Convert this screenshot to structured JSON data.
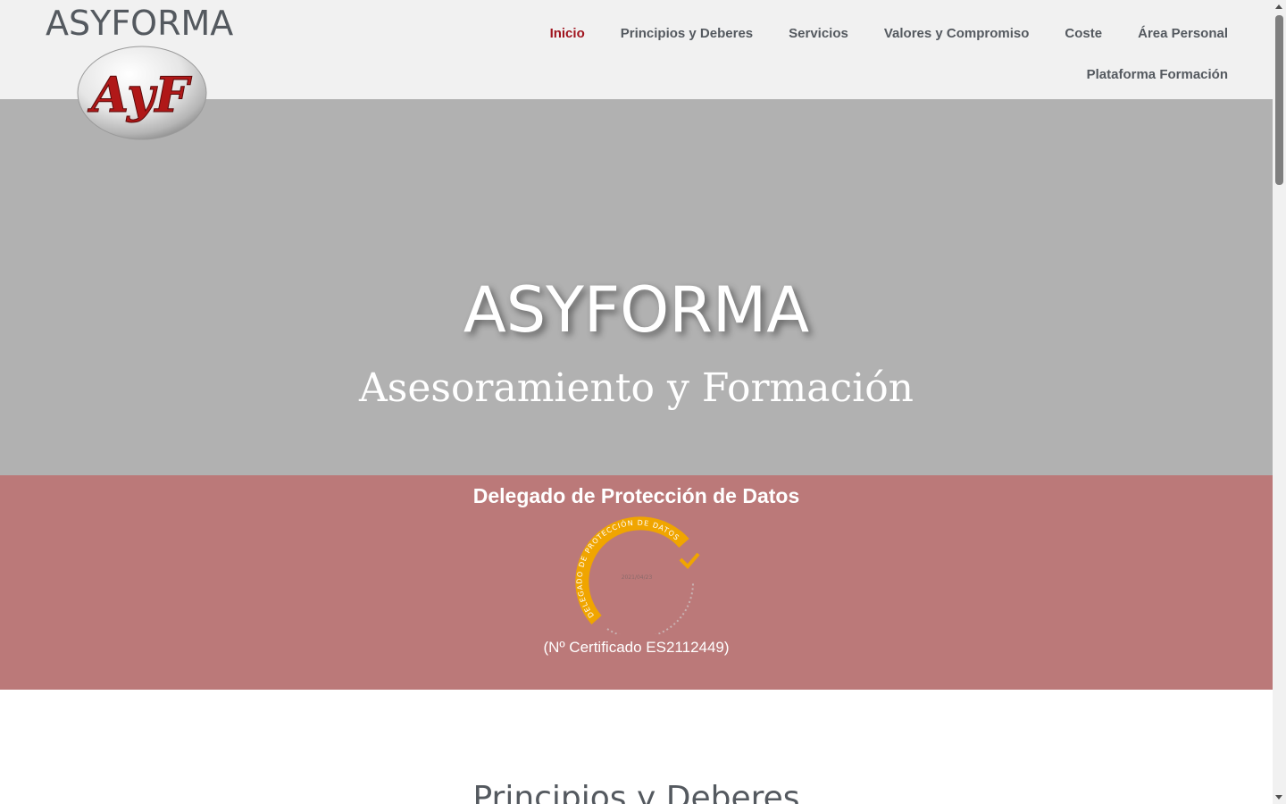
{
  "header": {
    "site_title": "ASYFORMA",
    "logo_text": "AyF",
    "nav": [
      {
        "label": "Inicio",
        "active": true
      },
      {
        "label": "Principios y Deberes",
        "active": false
      },
      {
        "label": "Servicios",
        "active": false
      },
      {
        "label": "Valores y Compromiso",
        "active": false
      },
      {
        "label": "Coste",
        "active": false
      },
      {
        "label": "Área Personal",
        "active": false
      },
      {
        "label": "Plataforma Formación",
        "active": false
      }
    ]
  },
  "hero": {
    "title": "ASYFORMA",
    "subtitle": "Asesoramiento y Formación"
  },
  "dpd": {
    "heading": "Delegado de Protección de Datos",
    "seal_text": "DELEGADO DE PROTECCIÓN DE DATOS",
    "seal_date": "2021/04/23",
    "certificate": "(Nº Certificado ES2112449)"
  },
  "section": {
    "title": "Principios y Deberes"
  },
  "colors": {
    "header_bg": "#f1f1f1",
    "hero_bg": "#b1b1b1",
    "dpd_bg": "#bb7979",
    "accent_active": "#a0141e",
    "text_gray": "#54595f",
    "seal_orange": "#f0a500"
  }
}
